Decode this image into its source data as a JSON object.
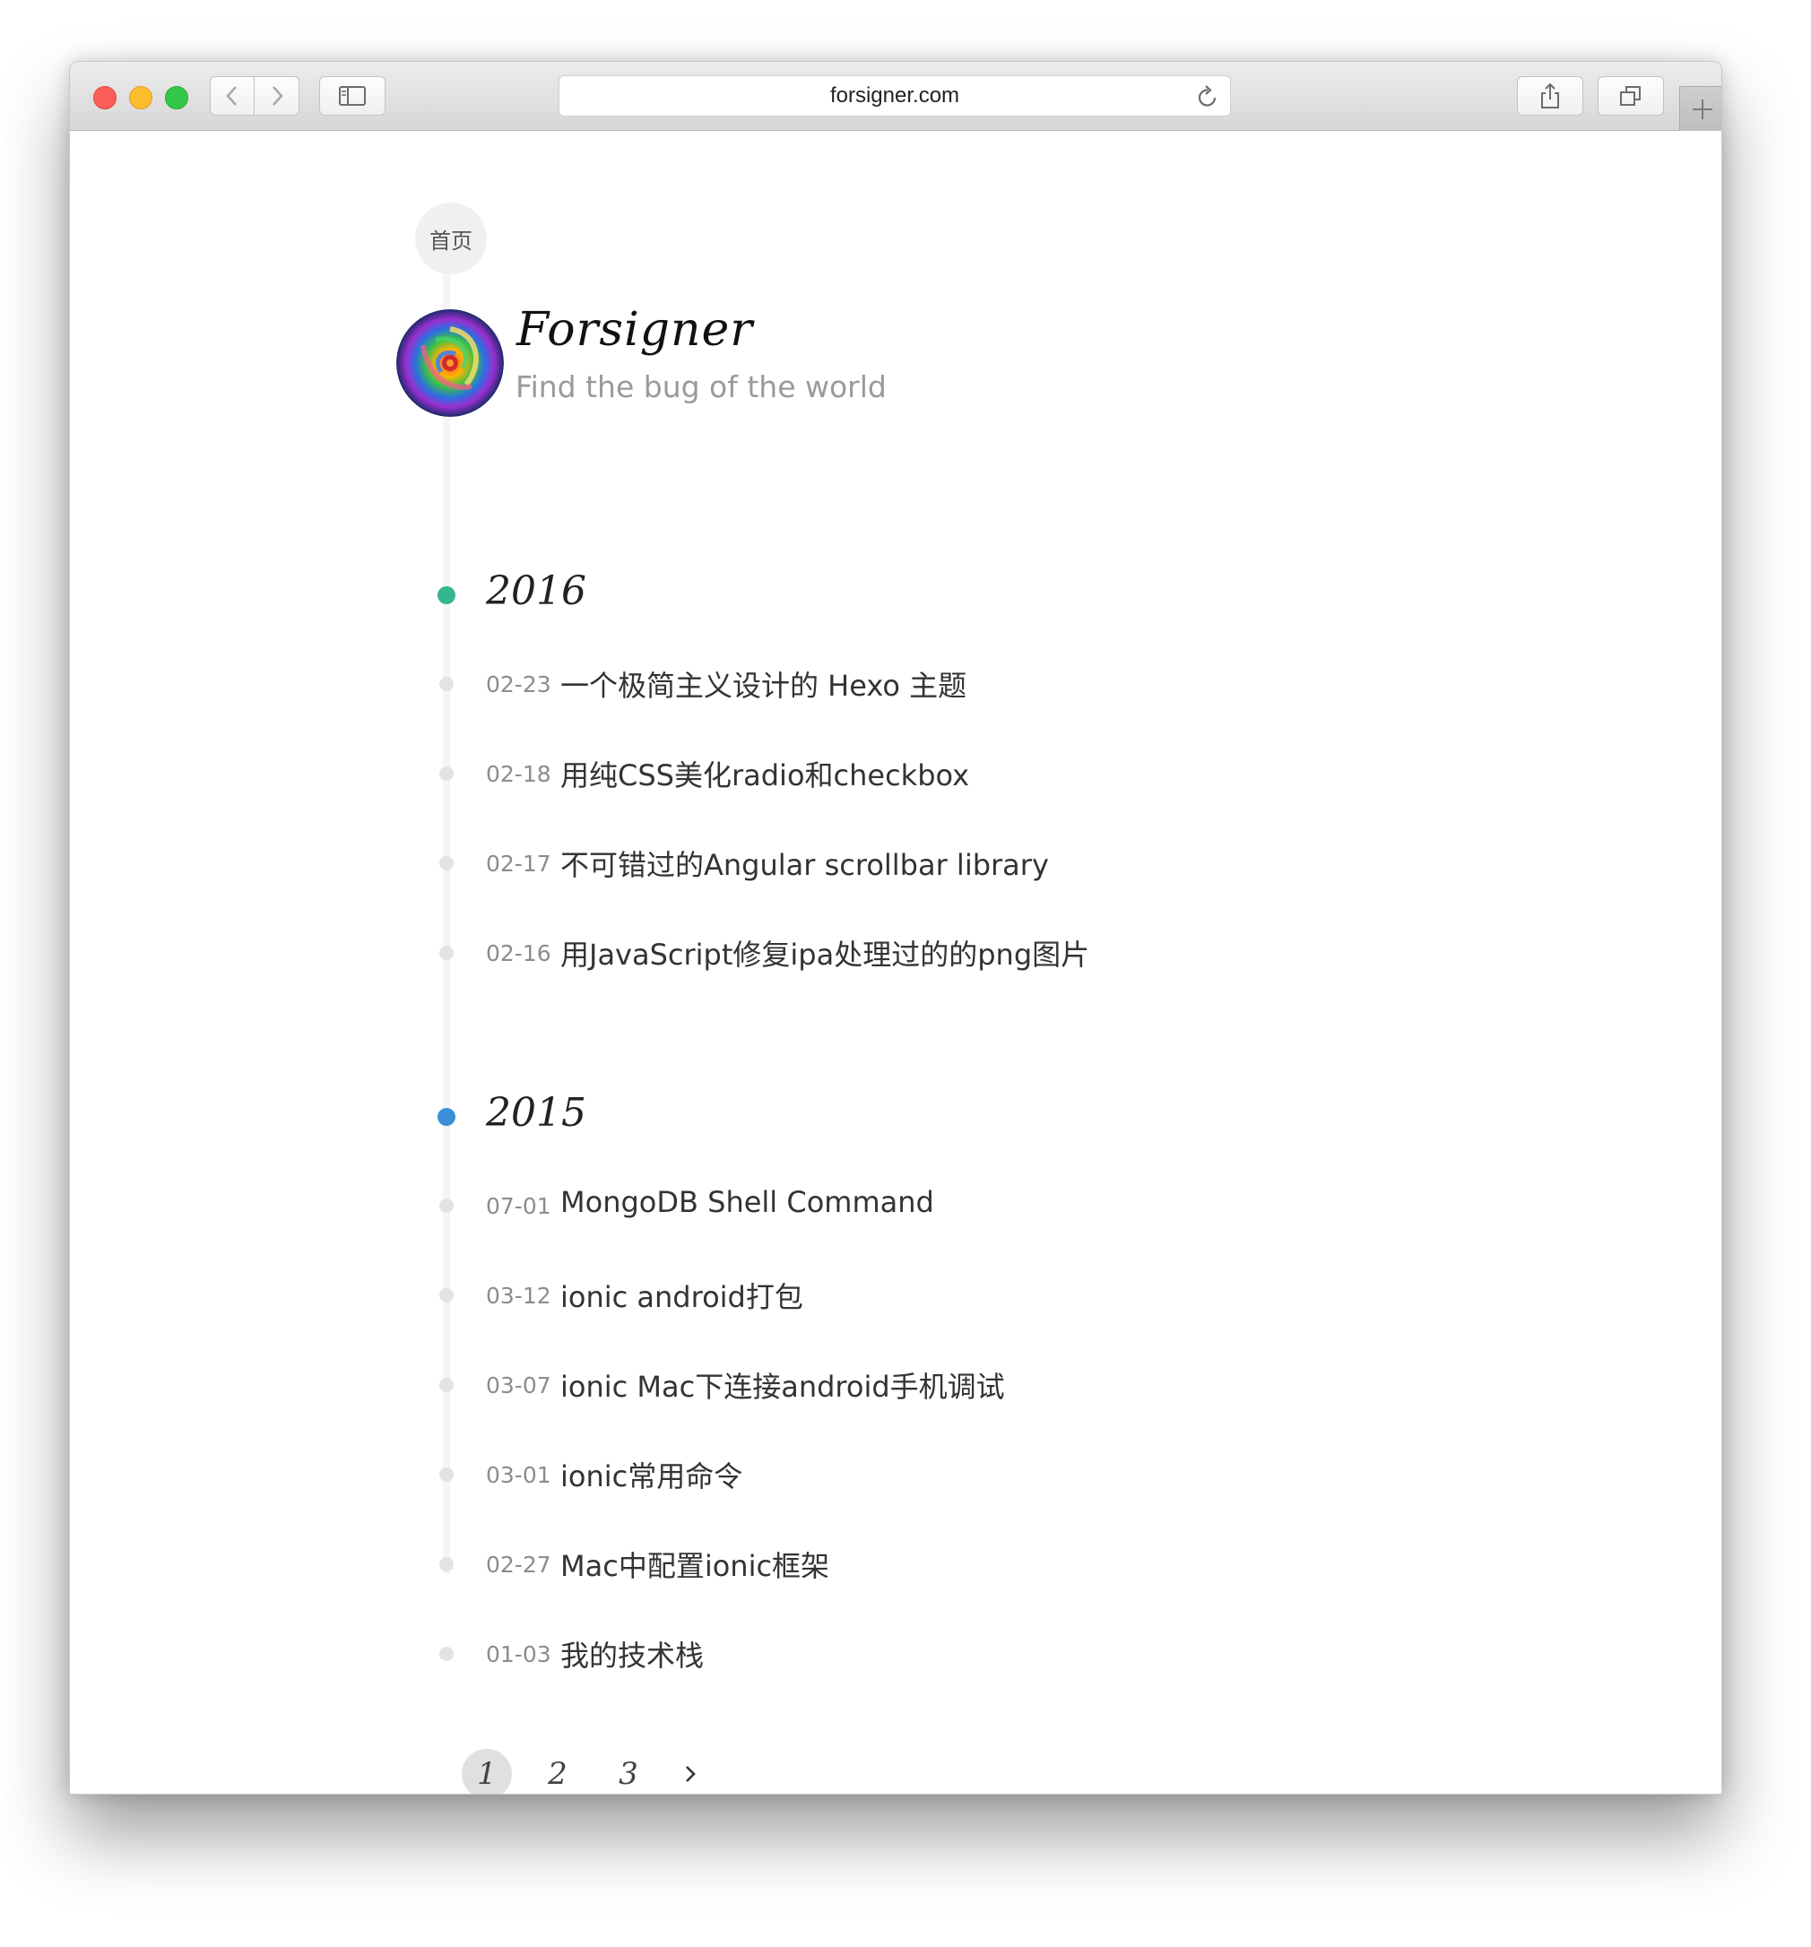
{
  "browser": {
    "url": "forsigner.com",
    "icons": {
      "back": "chevron-left-icon",
      "forward": "chevron-right-icon",
      "sidebar": "sidebar-icon",
      "reload": "reload-icon",
      "share": "share-icon",
      "tabs": "tabs-icon",
      "new_tab": "plus-icon"
    }
  },
  "page": {
    "home_label": "首页",
    "site_title": "Forsigner",
    "site_subtitle": "Find the bug of the world",
    "years": [
      {
        "year": "2016",
        "color": "#33b58f",
        "posts": [
          {
            "date": "02-23",
            "title": "一个极简主义设计的 Hexo 主题"
          },
          {
            "date": "02-18",
            "title": "用纯CSS美化radio和checkbox"
          },
          {
            "date": "02-17",
            "title": "不可错过的Angular scrollbar library"
          },
          {
            "date": "02-16",
            "title": "用JavaScript修复ipa处理过的的png图片"
          }
        ]
      },
      {
        "year": "2015",
        "color": "#3a8fd6",
        "posts": [
          {
            "date": "07-01",
            "title": "MongoDB Shell Command"
          },
          {
            "date": "03-12",
            "title": "ionic android打包"
          },
          {
            "date": "03-07",
            "title": "ionic Mac下连接android手机调试"
          },
          {
            "date": "03-01",
            "title": "ionic常用命令"
          },
          {
            "date": "02-27",
            "title": "Mac中配置ionic框架"
          },
          {
            "date": "01-03",
            "title": "我的技术栈"
          }
        ]
      }
    ],
    "pagination": {
      "pages": [
        "1",
        "2",
        "3"
      ],
      "current": "1",
      "next_icon": "chevron-right-icon"
    }
  }
}
